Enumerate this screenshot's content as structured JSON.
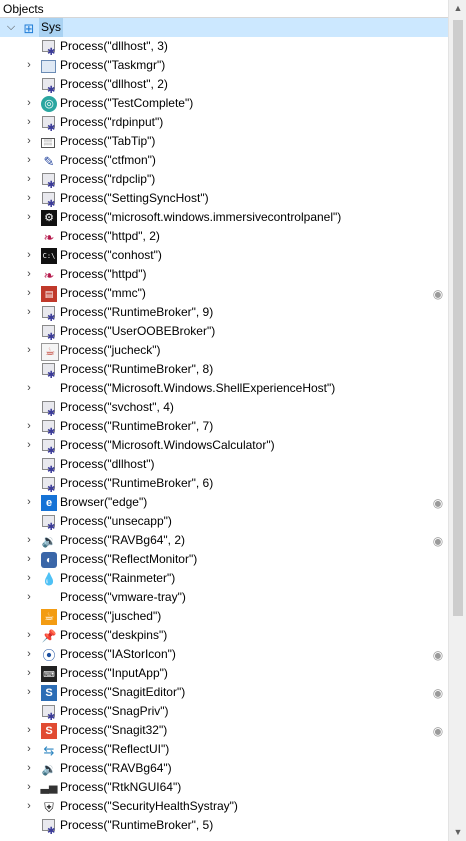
{
  "header": {
    "title": "Objects"
  },
  "root": {
    "label": "Sys"
  },
  "items": [
    {
      "label": "Process(\"dllhost\", 3)",
      "icon": "gear",
      "expandable": false,
      "eye": false
    },
    {
      "label": "Process(\"Taskmgr\")",
      "icon": "task",
      "expandable": true,
      "eye": false
    },
    {
      "label": "Process(\"dllhost\", 2)",
      "icon": "gear",
      "expandable": false,
      "eye": false
    },
    {
      "label": "Process(\"TestComplete\")",
      "icon": "tc",
      "expandable": true,
      "eye": false
    },
    {
      "label": "Process(\"rdpinput\")",
      "icon": "gear",
      "expandable": true,
      "eye": false
    },
    {
      "label": "Process(\"TabTip\")",
      "icon": "kbd",
      "expandable": true,
      "eye": false
    },
    {
      "label": "Process(\"ctfmon\")",
      "icon": "ctf",
      "expandable": true,
      "eye": false
    },
    {
      "label": "Process(\"rdpclip\")",
      "icon": "gear",
      "expandable": true,
      "eye": false
    },
    {
      "label": "Process(\"SettingSyncHost\")",
      "icon": "gear",
      "expandable": true,
      "eye": false
    },
    {
      "label": "Process(\"microsoft.windows.immersivecontrolpanel\")",
      "icon": "ctrl",
      "expandable": true,
      "eye": false
    },
    {
      "label": "Process(\"httpd\", 2)",
      "icon": "feather",
      "expandable": false,
      "eye": false
    },
    {
      "label": "Process(\"conhost\")",
      "icon": "cmd",
      "expandable": true,
      "eye": false
    },
    {
      "label": "Process(\"httpd\")",
      "icon": "feather",
      "expandable": true,
      "eye": false
    },
    {
      "label": "Process(\"mmc\")",
      "icon": "mmc",
      "expandable": true,
      "eye": true
    },
    {
      "label": "Process(\"RuntimeBroker\", 9)",
      "icon": "gear",
      "expandable": true,
      "eye": false
    },
    {
      "label": "Process(\"UserOOBEBroker\")",
      "icon": "gear",
      "expandable": false,
      "eye": false
    },
    {
      "label": "Process(\"jucheck\")",
      "icon": "java",
      "expandable": true,
      "eye": false
    },
    {
      "label": "Process(\"RuntimeBroker\", 8)",
      "icon": "gear",
      "expandable": false,
      "eye": false
    },
    {
      "label": "Process(\"Microsoft.Windows.ShellExperienceHost\")",
      "icon": "none",
      "expandable": true,
      "eye": false
    },
    {
      "label": "Process(\"svchost\", 4)",
      "icon": "gear",
      "expandable": false,
      "eye": false
    },
    {
      "label": "Process(\"RuntimeBroker\", 7)",
      "icon": "gear",
      "expandable": true,
      "eye": false
    },
    {
      "label": "Process(\"Microsoft.WindowsCalculator\")",
      "icon": "gear",
      "expandable": true,
      "eye": false
    },
    {
      "label": "Process(\"dllhost\")",
      "icon": "gear",
      "expandable": false,
      "eye": false
    },
    {
      "label": "Process(\"RuntimeBroker\", 6)",
      "icon": "gear",
      "expandable": false,
      "eye": false
    },
    {
      "label": "Browser(\"edge\")",
      "icon": "edge",
      "expandable": true,
      "eye": true
    },
    {
      "label": "Process(\"unsecapp\")",
      "icon": "gear",
      "expandable": false,
      "eye": false
    },
    {
      "label": "Process(\"RAVBg64\", 2)",
      "icon": "speaker",
      "expandable": true,
      "eye": true
    },
    {
      "label": "Process(\"ReflectMonitor\")",
      "icon": "reflect",
      "expandable": true,
      "eye": false
    },
    {
      "label": "Process(\"Rainmeter\")",
      "icon": "drop",
      "expandable": true,
      "eye": false
    },
    {
      "label": "Process(\"vmware-tray\")",
      "icon": "none",
      "expandable": true,
      "eye": false
    },
    {
      "label": "Process(\"jusched\")",
      "icon": "jsched",
      "expandable": false,
      "eye": false
    },
    {
      "label": "Process(\"deskpins\")",
      "icon": "pin",
      "expandable": true,
      "eye": false
    },
    {
      "label": "Process(\"IAStorIcon\")",
      "icon": "iastor",
      "expandable": true,
      "eye": true
    },
    {
      "label": "Process(\"InputApp\")",
      "icon": "input",
      "expandable": true,
      "eye": false
    },
    {
      "label": "Process(\"SnagitEditor\")",
      "icon": "snagit",
      "expandable": true,
      "eye": true
    },
    {
      "label": "Process(\"SnagPriv\")",
      "icon": "gear",
      "expandable": false,
      "eye": false
    },
    {
      "label": "Process(\"Snagit32\")",
      "icon": "snag32",
      "expandable": true,
      "eye": true
    },
    {
      "label": "Process(\"ReflectUI\")",
      "icon": "reflectui",
      "expandable": true,
      "eye": false
    },
    {
      "label": "Process(\"RAVBg64\")",
      "icon": "speaker",
      "expandable": true,
      "eye": false
    },
    {
      "label": "Process(\"RtkNGUI64\")",
      "icon": "rtk",
      "expandable": true,
      "eye": false
    },
    {
      "label": "Process(\"SecurityHealthSystray\")",
      "icon": "shield",
      "expandable": true,
      "eye": false
    },
    {
      "label": "Process(\"RuntimeBroker\", 5)",
      "icon": "gear",
      "expandable": false,
      "eye": false
    }
  ]
}
